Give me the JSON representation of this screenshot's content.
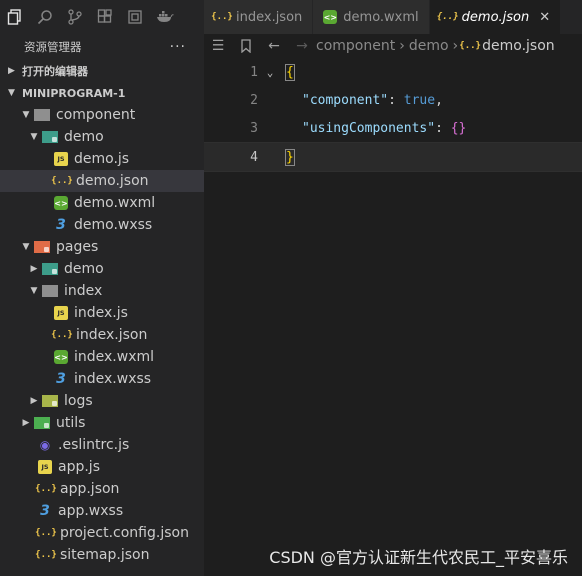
{
  "activity_bar": {
    "icons": [
      "files-icon",
      "search-icon",
      "source-control-icon",
      "extensions-icon",
      "debug-icon",
      "docker-icon"
    ]
  },
  "sidebar": {
    "title": "资源管理器",
    "more": "···",
    "open_editors": "打开的编辑器",
    "project": "MINIPROGRAM-1",
    "tree": [
      {
        "label": "component",
        "type": "folder-open",
        "depth": 1
      },
      {
        "label": "demo",
        "type": "folder-open",
        "depth": 2
      },
      {
        "label": "demo.js",
        "type": "js",
        "depth": 3
      },
      {
        "label": "demo.json",
        "type": "json",
        "depth": 3,
        "selected": true
      },
      {
        "label": "demo.wxml",
        "type": "wxml",
        "depth": 3
      },
      {
        "label": "demo.wxss",
        "type": "wxss",
        "depth": 3
      },
      {
        "label": "pages",
        "type": "folder-open",
        "depth": 1
      },
      {
        "label": "demo",
        "type": "folder-closed",
        "depth": 2
      },
      {
        "label": "index",
        "type": "folder-open",
        "depth": 2
      },
      {
        "label": "index.js",
        "type": "js",
        "depth": 3
      },
      {
        "label": "index.json",
        "type": "json",
        "depth": 3
      },
      {
        "label": "index.wxml",
        "type": "wxml",
        "depth": 3
      },
      {
        "label": "index.wxss",
        "type": "wxss",
        "depth": 3
      },
      {
        "label": "logs",
        "type": "folder-closed",
        "depth": 2
      },
      {
        "label": "utils",
        "type": "folder-closed",
        "depth": 1
      },
      {
        "label": ".eslintrc.js",
        "type": "eslint",
        "depth": 1
      },
      {
        "label": "app.js",
        "type": "js",
        "depth": 1
      },
      {
        "label": "app.json",
        "type": "json",
        "depth": 1
      },
      {
        "label": "app.wxss",
        "type": "wxss",
        "depth": 1
      },
      {
        "label": "project.config.json",
        "type": "json",
        "depth": 1
      },
      {
        "label": "sitemap.json",
        "type": "json",
        "depth": 1
      }
    ]
  },
  "tabs": [
    {
      "label": "index.json",
      "type": "json"
    },
    {
      "label": "demo.wxml",
      "type": "wxml"
    },
    {
      "label": "demo.json",
      "type": "json",
      "active": true,
      "close": "✕"
    }
  ],
  "breadcrumbs": [
    "component",
    "demo",
    "demo.json"
  ],
  "editor": {
    "line_numbers": [
      "1",
      "2",
      "3",
      "4"
    ],
    "line1": "{",
    "line2_key": "\"component\"",
    "line2_colon": ": ",
    "line2_value": "true",
    "line2_comma": ",",
    "line3_key": "\"usingComponents\"",
    "line3_colon": ": ",
    "line3_value": "{}",
    "line4": "}"
  },
  "watermark": "CSDN @官方认证新生代农民工_平安喜乐"
}
